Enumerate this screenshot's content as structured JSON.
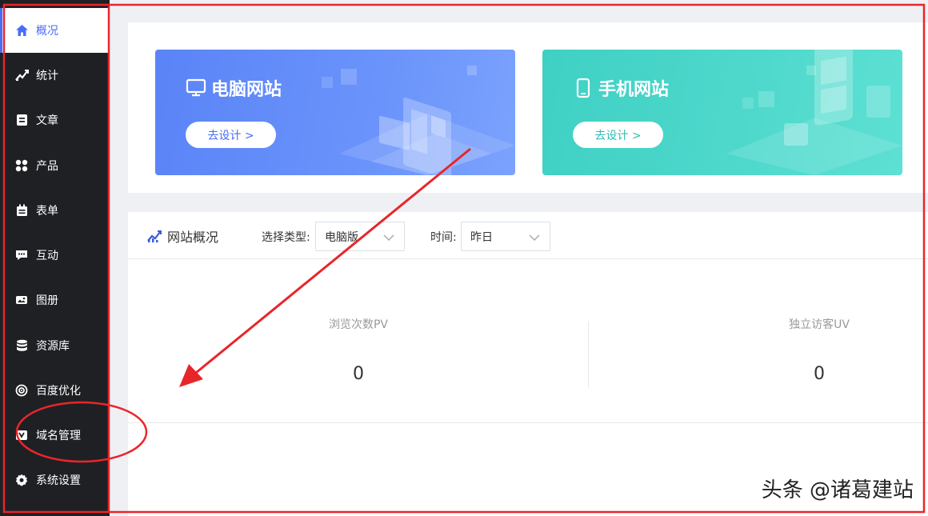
{
  "sidebar": {
    "items": [
      {
        "label": "概况",
        "icon": "home-icon"
      },
      {
        "label": "统计",
        "icon": "chart-icon"
      },
      {
        "label": "文章",
        "icon": "article-icon"
      },
      {
        "label": "产品",
        "icon": "grid-icon"
      },
      {
        "label": "表单",
        "icon": "calendar-icon"
      },
      {
        "label": "互动",
        "icon": "chat-icon"
      },
      {
        "label": "图册",
        "icon": "album-icon"
      },
      {
        "label": "资源库",
        "icon": "database-icon"
      },
      {
        "label": "百度优化",
        "icon": "target-icon"
      },
      {
        "label": "域名管理",
        "icon": "domain-icon"
      },
      {
        "label": "系统设置",
        "icon": "gear-icon"
      }
    ]
  },
  "cards": {
    "pc": {
      "title": "电脑网站",
      "button": "去设计 >"
    },
    "mobile": {
      "title": "手机网站",
      "button": "去设计 >"
    }
  },
  "overview": {
    "title": "网站概况",
    "type_label": "选择类型:",
    "type_value": "电脑版",
    "time_label": "时间:",
    "time_value": "昨日",
    "stats": [
      {
        "label": "浏览次数PV",
        "value": "0"
      },
      {
        "label": "独立访客UV",
        "value": "0"
      }
    ]
  },
  "watermark": "头条 @诸葛建站",
  "colors": {
    "accent": "#4a6cf7",
    "sidebar_bg": "#1f2024",
    "annotation_red": "#e8262a"
  }
}
